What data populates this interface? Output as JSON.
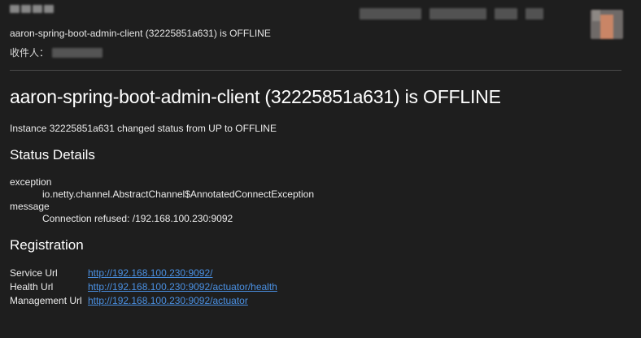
{
  "email": {
    "subject": "aaron-spring-boot-admin-client (32225851a631) is OFFLINE",
    "to_label": "收件人："
  },
  "body": {
    "title": "aaron-spring-boot-admin-client (32225851a631) is OFFLINE",
    "summary": "Instance 32225851a631 changed status from UP to OFFLINE",
    "status_heading": "Status Details",
    "status_details": [
      {
        "key": "exception",
        "value": "io.netty.channel.AbstractChannel$AnnotatedConnectException"
      },
      {
        "key": "message",
        "value": "Connection refused: /192.168.100.230:9092"
      }
    ],
    "registration_heading": "Registration",
    "registration": [
      {
        "key": "Service Url",
        "value": "http://192.168.100.230:9092/"
      },
      {
        "key": "Health Url",
        "value": "http://192.168.100.230:9092/actuator/health"
      },
      {
        "key": "Management Url",
        "value": "http://192.168.100.230:9092/actuator"
      }
    ]
  },
  "colors": {
    "background": "#1e1e1e",
    "text": "#ececec",
    "link": "#4a90e2"
  }
}
